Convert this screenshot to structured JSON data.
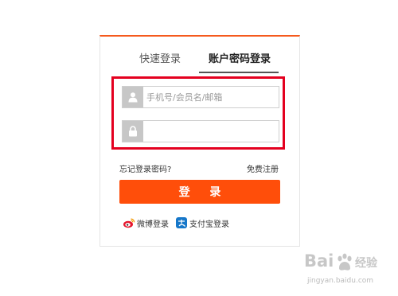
{
  "tabs": {
    "quick_login": "快速登录",
    "account_login": "账户密码登录"
  },
  "form": {
    "username_placeholder": "手机号/会员名/邮箱",
    "username_value": "",
    "password_value": ""
  },
  "links": {
    "forgot_password": "忘记登录密码?",
    "register": "免费注册"
  },
  "login_button": "登 录",
  "social": {
    "weibo": "微博登录",
    "alipay": "支付宝登录"
  },
  "icons": {
    "user": "user-icon",
    "lock": "lock-icon",
    "weibo": "weibo-icon",
    "alipay": "alipay-icon"
  },
  "colors": {
    "accent": "#ff4e0a",
    "highlight": "#e4001f"
  },
  "watermark": {
    "brand_a": "Bai",
    "brand_b": "经验",
    "url": "jingyan.baidu.com"
  }
}
